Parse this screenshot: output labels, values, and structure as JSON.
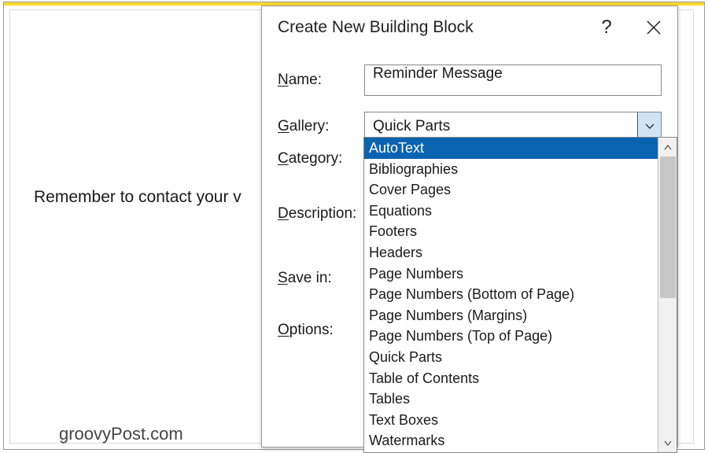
{
  "document": {
    "visible_text": "Remember to contact your v",
    "watermark": "groovyPost.com"
  },
  "dialog": {
    "title": "Create New Building Block",
    "labels": {
      "name": "Name:",
      "name_mn": "N",
      "gallery": "Gallery:",
      "gallery_mn": "G",
      "category": "Category:",
      "category_mn": "C",
      "description": "Description:",
      "description_mn": "D",
      "save_in": "Save in:",
      "save_in_mn": "S",
      "options": "Options:",
      "options_mn": "O"
    },
    "name_value": "Reminder Message",
    "gallery_selected": "Quick Parts",
    "gallery_options": [
      "AutoText",
      "Bibliographies",
      "Cover Pages",
      "Equations",
      "Footers",
      "Headers",
      "Page Numbers",
      "Page Numbers (Bottom of Page)",
      "Page Numbers (Margins)",
      "Page Numbers (Top of Page)",
      "Quick Parts",
      "Table of Contents",
      "Tables",
      "Text Boxes",
      "Watermarks"
    ],
    "gallery_highlighted_index": 0
  }
}
